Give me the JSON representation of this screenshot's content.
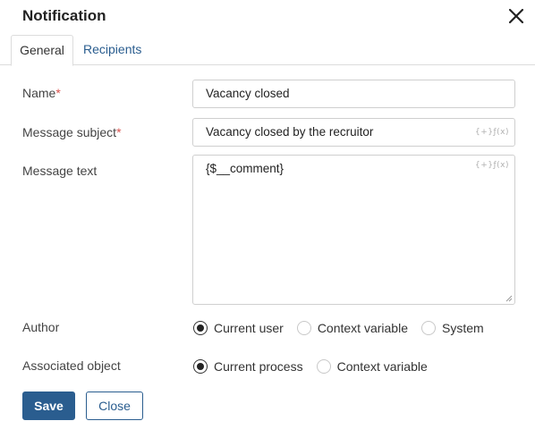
{
  "dialog": {
    "title": "Notification"
  },
  "tabs": [
    {
      "label": "General",
      "active": true
    },
    {
      "label": "Recipients",
      "active": false
    }
  ],
  "form": {
    "name": {
      "label": "Name",
      "required_mark": "*",
      "value": "Vacancy closed"
    },
    "subject": {
      "label": "Message subject",
      "required_mark": "*",
      "value": "Vacancy closed by the recruitor",
      "fx_hint": "{+}ƒ(x)"
    },
    "text": {
      "label": "Message text",
      "value": "{$__comment}",
      "fx_hint": "{+}ƒ(x)"
    },
    "author": {
      "label": "Author",
      "options": [
        {
          "label": "Current user",
          "checked": true
        },
        {
          "label": "Context variable",
          "checked": false
        },
        {
          "label": "System",
          "checked": false
        }
      ]
    },
    "associated": {
      "label": "Associated object",
      "options": [
        {
          "label": "Current process",
          "checked": true
        },
        {
          "label": "Context variable",
          "checked": false
        }
      ]
    }
  },
  "buttons": {
    "save": "Save",
    "close": "Close"
  },
  "colors": {
    "accent": "#2a5d8f",
    "required": "#d9534f"
  }
}
